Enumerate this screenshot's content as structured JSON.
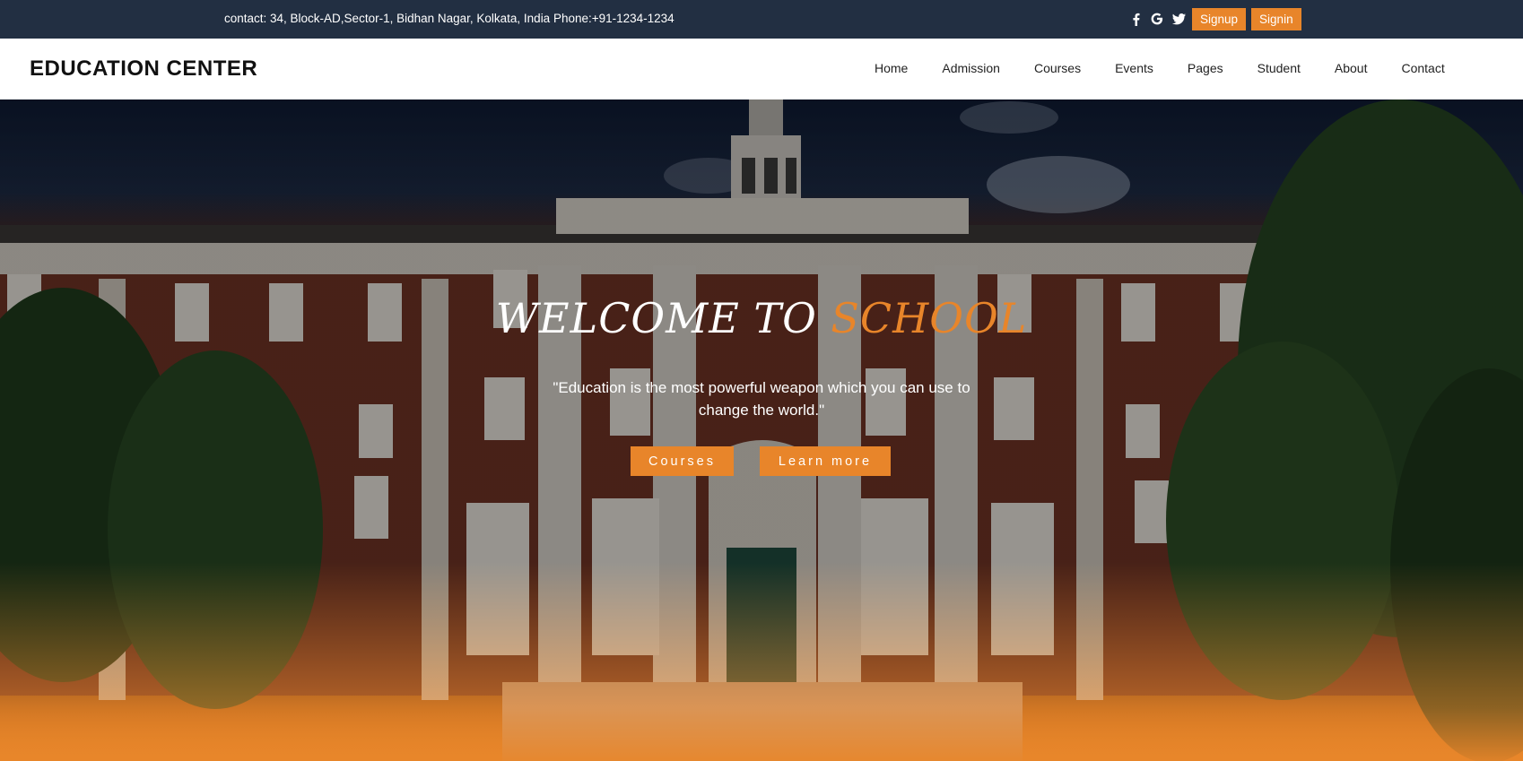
{
  "topbar": {
    "contact": "contact: 34, Block-AD,Sector-1, Bidhan Nagar, Kolkata, India Phone:+91-1234-1234",
    "social_icons": [
      "facebook-icon",
      "google-icon",
      "twitter-icon"
    ],
    "signup_label": "Signup",
    "signin_label": "Signin"
  },
  "header": {
    "brand": "EDUCATION CENTER",
    "nav": [
      "Home",
      "Admission",
      "Courses",
      "Events",
      "Pages",
      "Student",
      "About",
      "Contact"
    ]
  },
  "hero": {
    "title_main": "WELCOME TO",
    "title_accent": "SCHOOL",
    "quote": "\"Education is the most powerful weapon which you can use to change the world.\"",
    "courses_label": "Courses",
    "learn_more_label": "Learn more"
  },
  "colors": {
    "topbar_bg": "#222f42",
    "accent": "#e8852a",
    "header_bg": "#ffffff"
  }
}
